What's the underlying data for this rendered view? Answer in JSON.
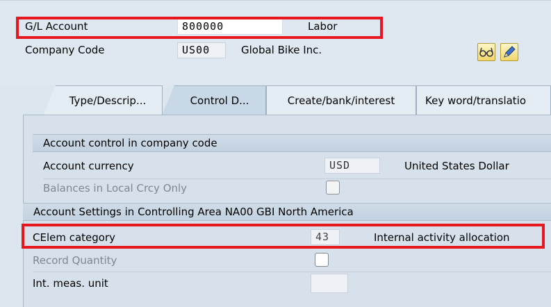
{
  "header": {
    "gl_account_label": "G/L Account",
    "gl_account_value": "800000",
    "gl_account_desc": "Labor",
    "company_code_label": "Company Code",
    "company_code_value": "US00",
    "company_name": "Global Bike Inc."
  },
  "icons": [
    "glasses-icon",
    "pencil-icon"
  ],
  "tabs": [
    {
      "label": "Type/Descrip...",
      "active": false
    },
    {
      "label": "Control D...",
      "active": true
    },
    {
      "label": "Create/bank/interest",
      "active": false
    },
    {
      "label": "Key word/translatio",
      "active": false
    }
  ],
  "account_control": {
    "title": "Account control in company code",
    "currency_label": "Account currency",
    "currency_value": "USD",
    "currency_desc": "United States Dollar",
    "balances_label": "Balances in Local Crcy Only"
  },
  "controlling": {
    "title": "Account Settings in Controlling Area NA00 GBI North America",
    "celem_label": "CElem category",
    "celem_value": "43",
    "celem_desc": "Internal activity allocation",
    "record_qty_label": "Record Quantity",
    "meas_unit_label": "Int. meas. unit",
    "meas_unit_value": ""
  },
  "colors": {
    "highlight": "#e8171d",
    "background": "#dce6ee",
    "section_header": "#c8d6e4"
  }
}
